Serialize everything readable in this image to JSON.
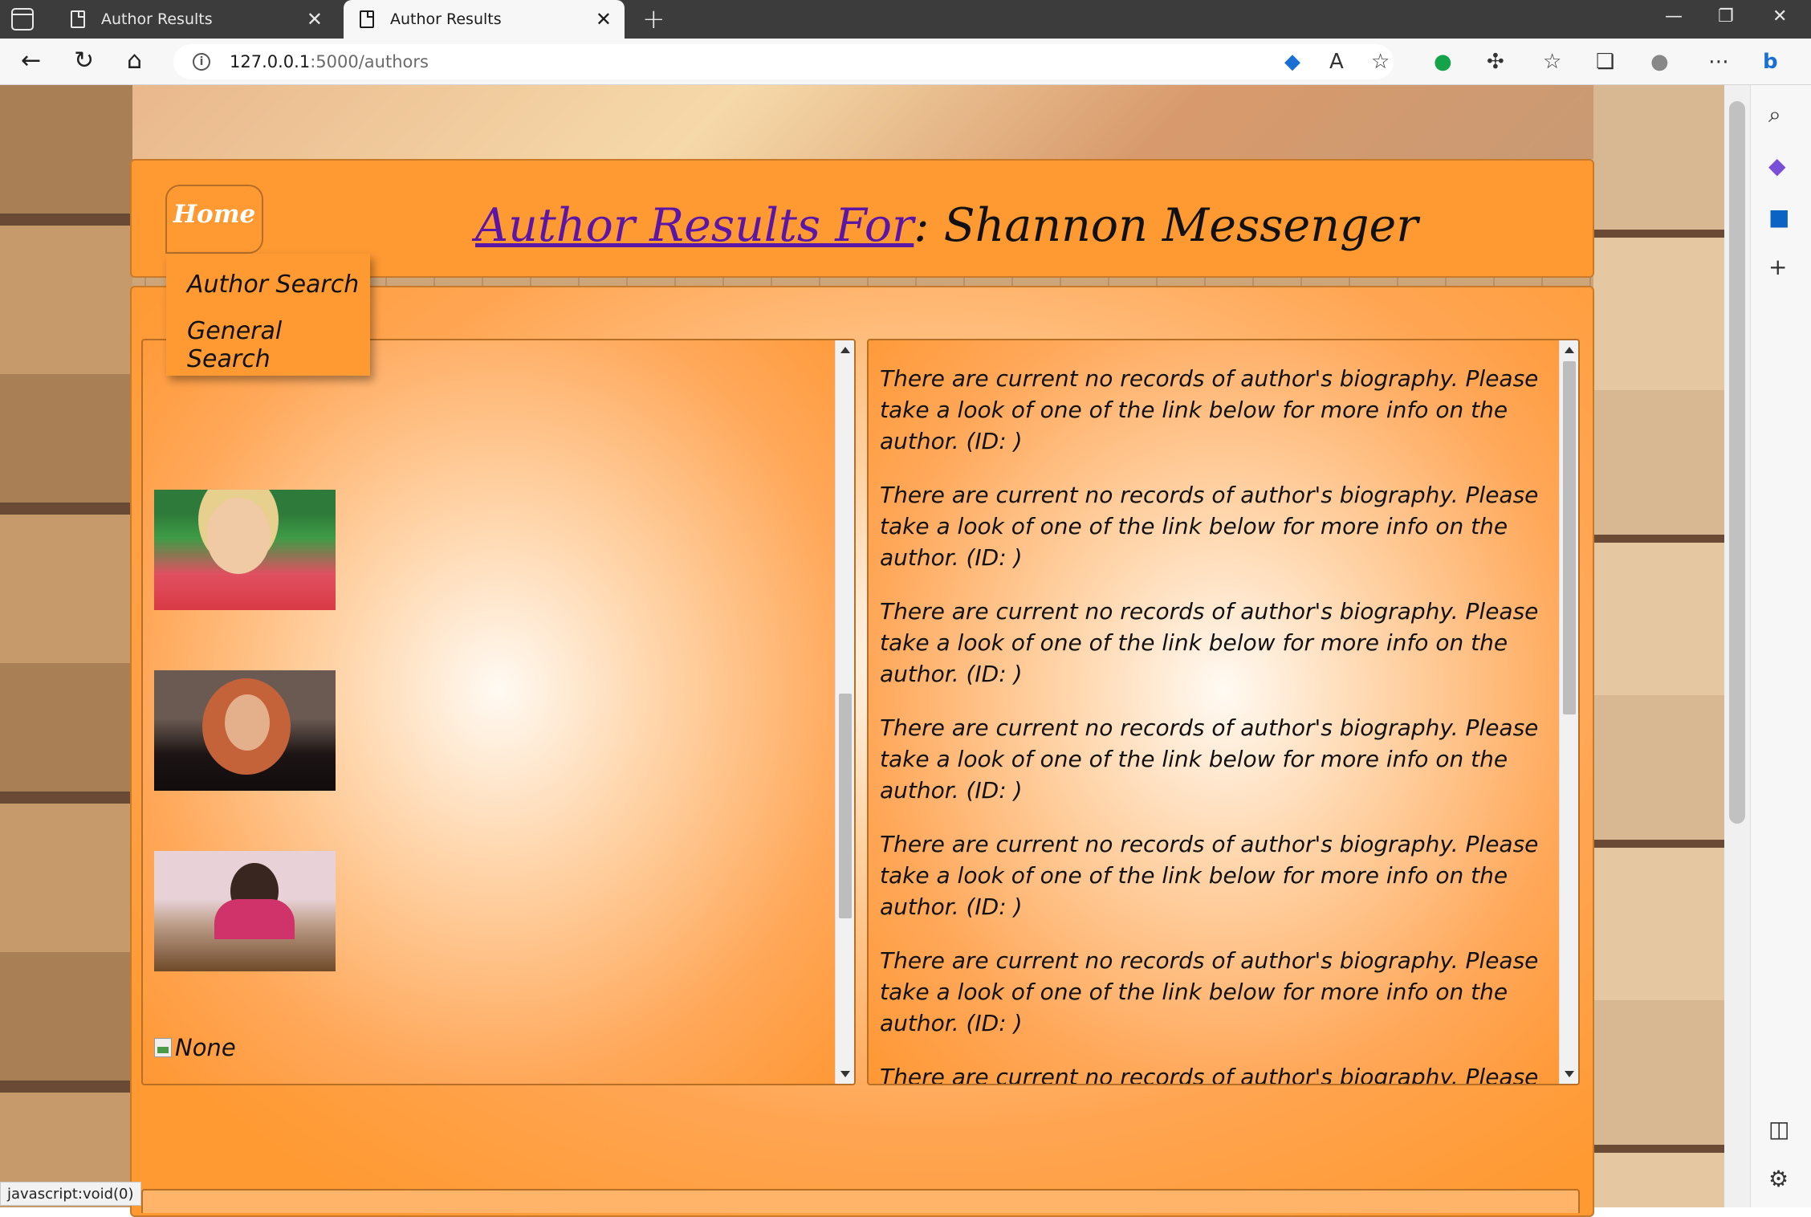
{
  "browser": {
    "tabs": [
      {
        "title": "Author Results",
        "active": false
      },
      {
        "title": "Author Results",
        "active": true
      }
    ],
    "url_host": "127.0.0.1",
    "url_rest": ":5000/authors",
    "status_text": "javascript:void(0)"
  },
  "header": {
    "home_label": "Home",
    "title_link": "Author Results For",
    "title_rest": ": Shannon Messenger"
  },
  "nav_menu": {
    "items": [
      {
        "label": "Author Search"
      },
      {
        "label": "General Search"
      }
    ]
  },
  "images": {
    "missing_alt": "None"
  },
  "biographies": [
    "There are current no records of author's biography. Please take a look of one of the link below for more info on the author. (ID: )",
    "There are current no records of author's biography. Please take a look of one of the link below for more info on the author. (ID: )",
    "There are current no records of author's biography. Please take a look of one of the link below for more info on the author. (ID: )",
    "There are current no records of author's biography. Please take a look of one of the link below for more info on the author. (ID: )",
    "There are current no records of author's biography. Please take a look of one of the link below for more info on the author. (ID: )",
    "There are current no records of author's biography. Please take a look of one of the link below for more info on the author. (ID: )",
    "There are current no records of author's biography. Please take a look of one of the link below for more info on the author. (ID: )"
  ],
  "colors": {
    "panel_orange": "#ff9a33",
    "link_purple": "#5b16a6"
  }
}
